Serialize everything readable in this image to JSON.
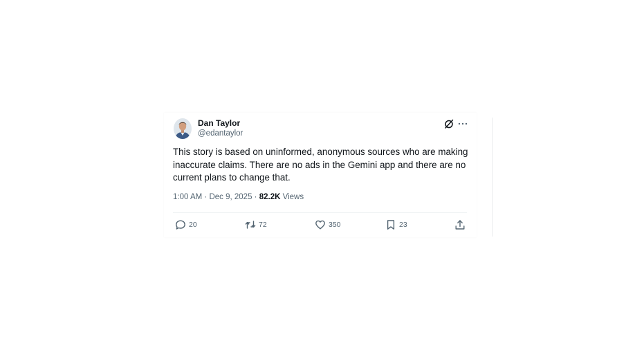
{
  "tweet": {
    "author": {
      "name": "Dan Taylor",
      "handle": "@edantaylor",
      "avatar_icon": "profile-photo"
    },
    "header_icons": [
      "grok-icon",
      "more-options-icon"
    ],
    "text": "This story is based on uninformed, anonymous sources who are making inaccurate claims. There are no ads in the Gemini app and there are no current plans to change that.",
    "time": "1:00 AM",
    "separator": "·",
    "date": "Dec 9, 2025",
    "views_count": "82.2K",
    "views_label": "Views",
    "actions": {
      "replies": "20",
      "reposts": "72",
      "likes": "350",
      "bookmarks": "23"
    }
  },
  "colors": {
    "text_primary": "#0f1419",
    "text_secondary": "#536471",
    "divider": "#eff3f4",
    "background": "#ffffff"
  }
}
